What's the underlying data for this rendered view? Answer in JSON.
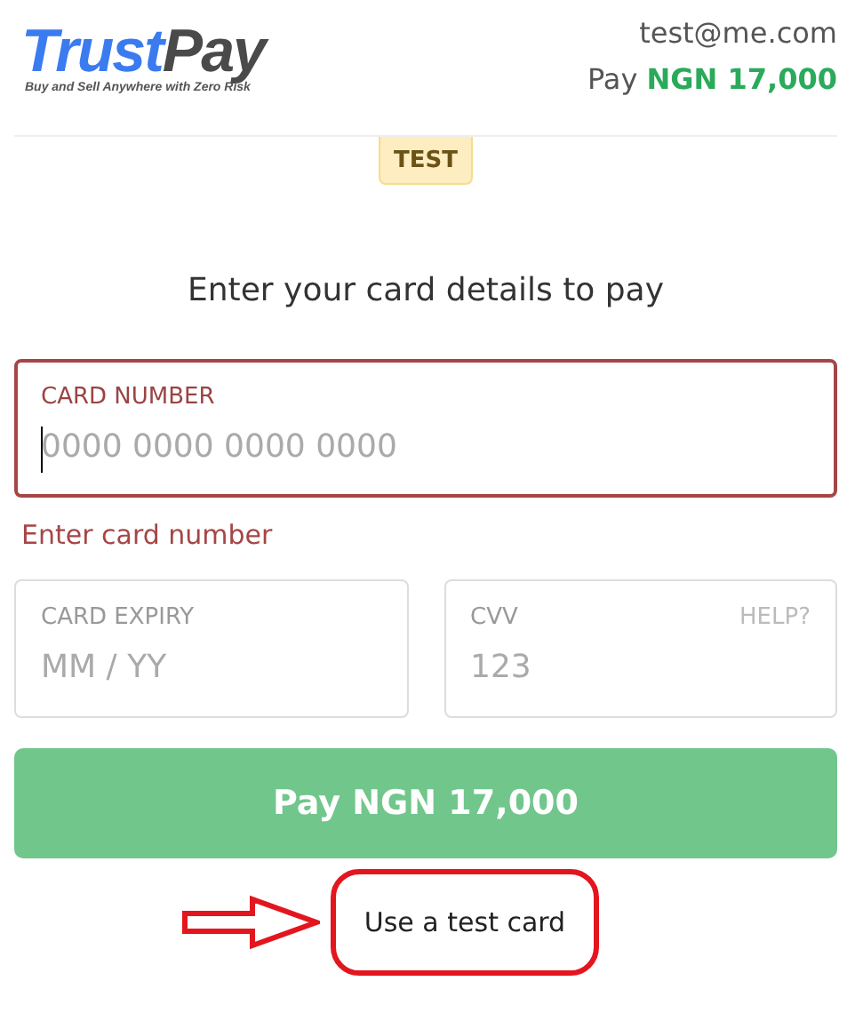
{
  "header": {
    "logo": {
      "brand_first": "Trust",
      "brand_second": "Pay",
      "tagline": "Buy and Sell Anywhere with Zero Risk"
    },
    "email": "test@me.com",
    "pay_line": "Pay **NGN 17,000**"
  },
  "mode_badge": "TEST",
  "heading": "Enter your card details to pay",
  "card_number": {
    "label": "CARD NUMBER",
    "placeholder": "0000 0000 0000 0000",
    "error": true,
    "error_message": "Enter card number"
  },
  "card_expiry": {
    "label": "CARD EXPIRY",
    "placeholder": "MM / YY",
    "error": false
  },
  "cvv": {
    "label": "CVV",
    "help": "HELP?",
    "placeholder": "123",
    "error": false
  },
  "pay_button": {
    "label": "Pay NGN 17,000",
    "disabled": true
  },
  "test_card_link": {
    "label": "Use a test card",
    "highlighted": true
  }
}
